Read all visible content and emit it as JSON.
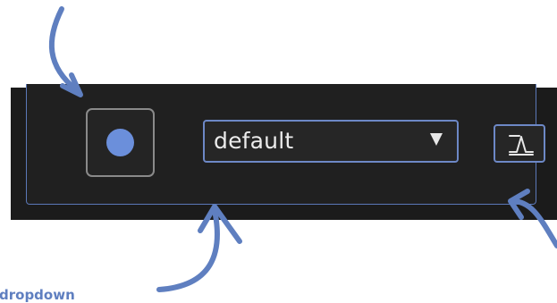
{
  "toolbar": {
    "record_button_icon": "record-dot-icon",
    "preset_dropdown": {
      "selected": "default",
      "caret_icon": "dropdown-caret-icon"
    },
    "envelope_button_icon": "envelope-curve-icon"
  },
  "annotation_text": {
    "partial_label": "dropdown"
  },
  "colors": {
    "panel_background": "#1b1b1b",
    "accent_blue": "#6d88c6",
    "record_dot": "#6b8fdb",
    "annotation_arrow": "#5f7fc0"
  }
}
